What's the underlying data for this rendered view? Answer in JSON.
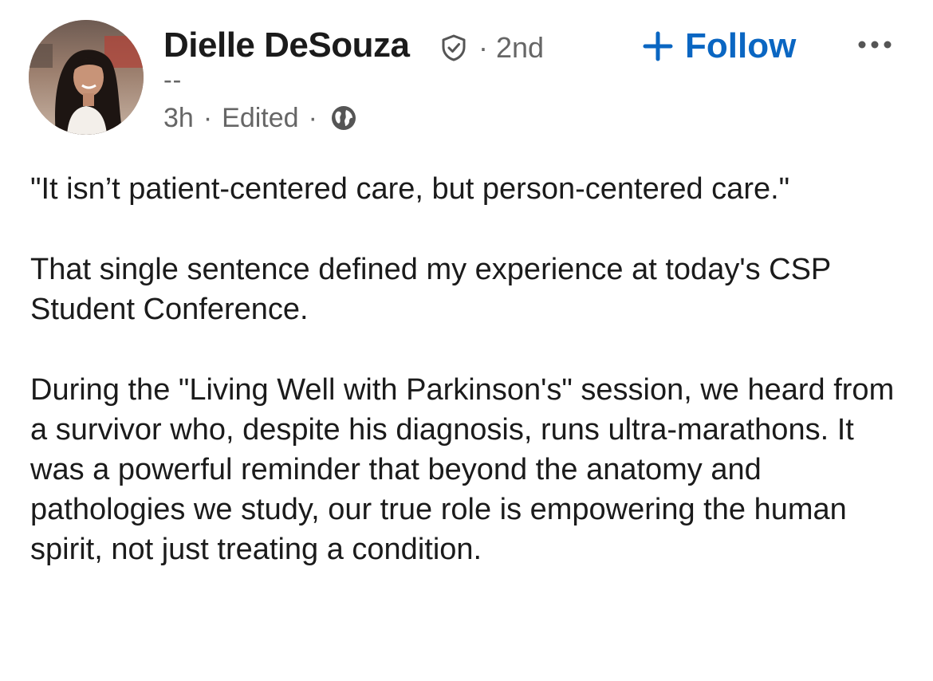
{
  "author": {
    "name": "Dielle DeSouza",
    "degree": "2nd",
    "headline": "--",
    "time": "3h",
    "edited": "Edited"
  },
  "actions": {
    "follow_label": "Follow"
  },
  "icons": {
    "verified": "verified-shield-icon",
    "visibility": "globe-icon",
    "follow": "plus-icon",
    "more": "more-horizontal-icon"
  },
  "colors": {
    "accent": "#0a66c2",
    "text": "#1b1b1b",
    "secondary_text": "#666666"
  },
  "post": {
    "paragraphs": [
      "\"It isn’t patient-centered care, but person-centered care.\"",
      "That single sentence defined my experience at today's CSP Student Conference.",
      "During the \"Living Well with Parkinson's\" session, we heard from a survivor who, despite his diagnosis, runs ultra-marathons. It was a powerful reminder that beyond the anatomy and pathologies we study, our true role is empowering the human spirit, not just treating a condition."
    ]
  }
}
